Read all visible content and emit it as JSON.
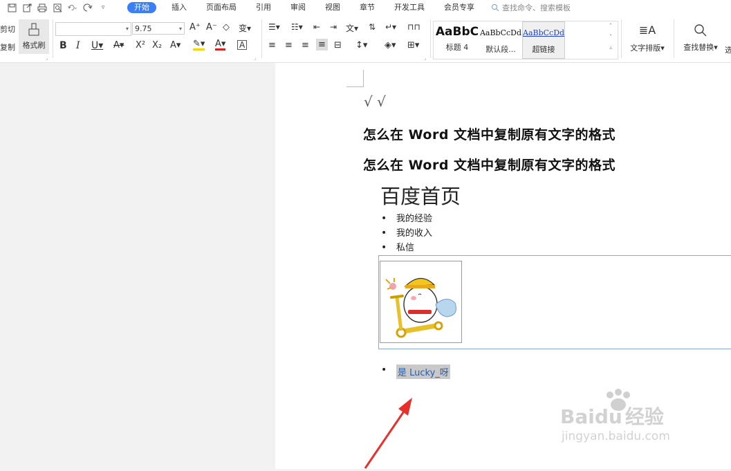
{
  "quick_access": [
    "save-icon",
    "export-icon",
    "print-icon",
    "print-preview-icon",
    "undo-icon",
    "redo-icon",
    "customize-icon"
  ],
  "menu": {
    "tabs": [
      "开始",
      "插入",
      "页面布局",
      "引用",
      "审阅",
      "视图",
      "章节",
      "开发工具",
      "会员专享"
    ],
    "active_tab": "开始",
    "search_placeholder": "查找命令、搜索模板"
  },
  "ribbon": {
    "cut_label": "剪切",
    "copy_label": "复制",
    "format_painter_label": "格式刷",
    "font_size": "9.75",
    "styles": [
      {
        "preview": "AaBbC",
        "name": "标题 4"
      },
      {
        "preview": "AaBbCcDd",
        "name": "默认段..."
      },
      {
        "preview": "AaBbCcDd",
        "name": "超链接"
      }
    ],
    "text_layout_label": "文字排版",
    "find_replace_label": "查找替换",
    "select_label": "选"
  },
  "document": {
    "sqrt_marks": "√ √",
    "headings": [
      "怎么在 Word 文档中复制原有文字的格式",
      "怎么在 Word 文档中复制原有文字的格式"
    ],
    "page_title": "百度首页",
    "list_items": [
      "我的经验",
      "我的收入",
      "私信"
    ],
    "selected_text": "是 Lucky_呀"
  },
  "watermark": {
    "brand": "Baidu",
    "suffix": "经验",
    "url": "jingyan.baidu.com"
  },
  "colors": {
    "accent": "#3b7ef6",
    "arrow": "#e8302a",
    "selection": "#c9c9c9",
    "link": "#2a5caa"
  }
}
